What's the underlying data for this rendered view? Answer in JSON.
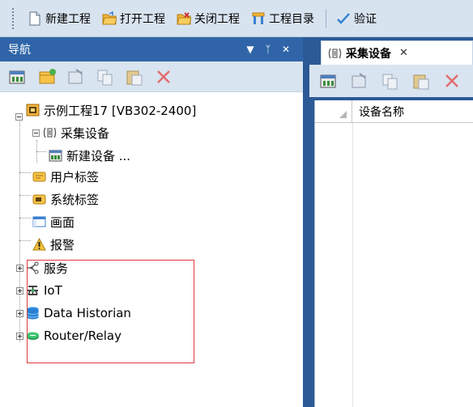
{
  "toolbar": {
    "new_project": "新建工程",
    "open_project": "打开工程",
    "close_project": "关闭工程",
    "project_dir": "工程目录",
    "verify": "验证"
  },
  "nav": {
    "title": "导航",
    "header_buttons": [
      "▼",
      "ᛉ",
      "✕"
    ]
  },
  "tree": {
    "project": "示例工程17 [VB302-2400]",
    "collect_devices": "采集设备",
    "new_device": "新建设备 ...",
    "user_tags": "用户标签",
    "system_tags": "系统标签",
    "screen": "画面",
    "alarm": "报警",
    "service": "服务",
    "iot": "IoT",
    "data_historian": "Data Historian",
    "router_relay": "Router/Relay"
  },
  "doc": {
    "tab_label": "采集设备",
    "tab_close": "✕",
    "column_device_name": "设备名称"
  },
  "colors": {
    "accent": "#2f65a8",
    "highlight": "#e0393e"
  }
}
